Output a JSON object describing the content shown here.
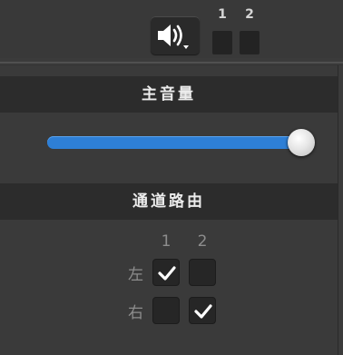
{
  "toolbar": {
    "volume_button": {
      "icon": "speaker-volume-icon",
      "has_dropdown": true
    },
    "meters": [
      {
        "label": "1"
      },
      {
        "label": "2"
      }
    ]
  },
  "popup": {
    "master_volume": {
      "title": "主音量",
      "level_percent": 100
    },
    "channel_routing": {
      "title": "通道路由",
      "columns": [
        "1",
        "2"
      ],
      "rows": [
        {
          "label": "左",
          "checked": [
            true,
            false
          ]
        },
        {
          "label": "右",
          "checked": [
            false,
            true
          ]
        }
      ]
    }
  },
  "colors": {
    "accent": "#2e7fd6",
    "header_bg": "#2c2c2c",
    "panel_bg": "#3a3a3a",
    "checkbox_bg": "#262626"
  }
}
